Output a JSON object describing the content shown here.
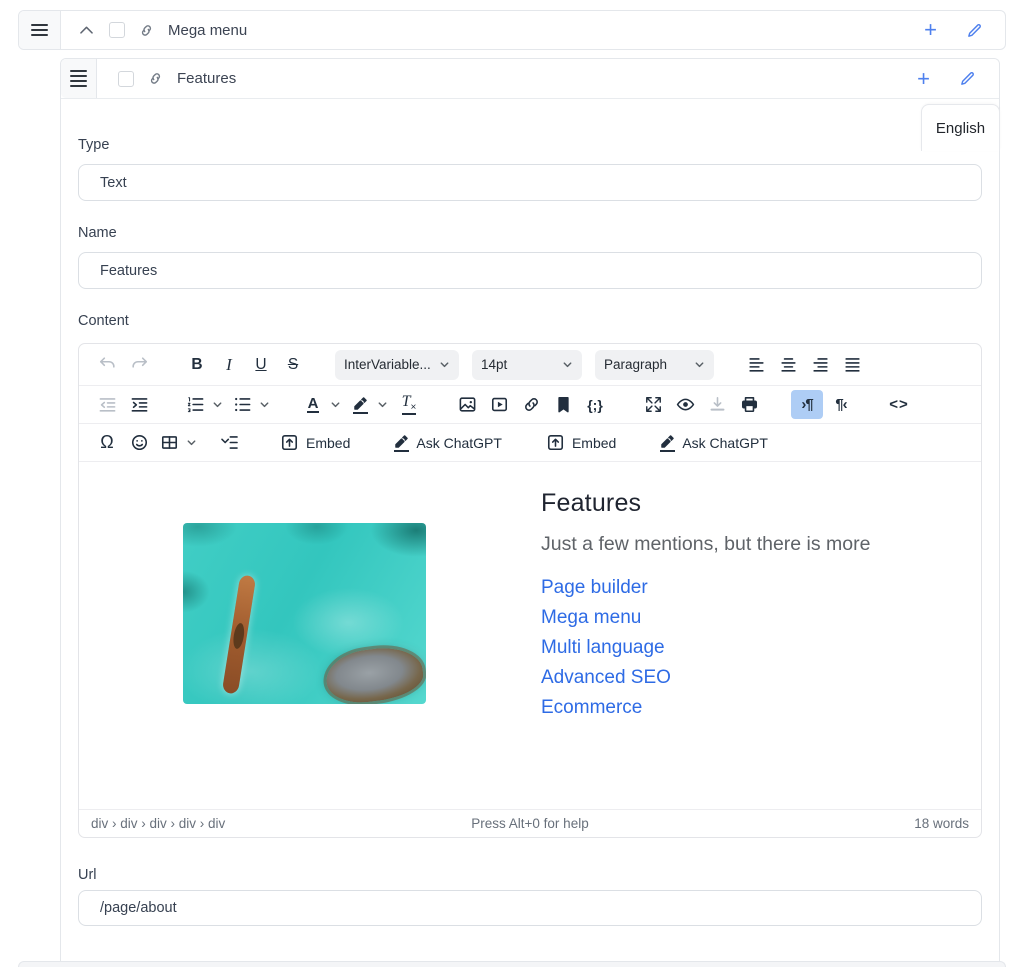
{
  "colors": {
    "accent_blue": "#4e80ee",
    "active_toolbar_bg": "#aecdf5",
    "link_blue": "#2e6be5",
    "icon_dark": "#222f3e",
    "border": "#e4e7eb"
  },
  "outer_row": {
    "title": "Mega menu"
  },
  "panel": {
    "title": "Features",
    "language_tab": "English"
  },
  "fields": {
    "type_label": "Type",
    "type_value": "Text",
    "name_label": "Name",
    "name_value": "Features",
    "content_label": "Content",
    "url_label": "Url",
    "url_value": "/page/about"
  },
  "editor": {
    "toolbar": {
      "font_family": "InterVariable...",
      "font_size": "14pt",
      "block_format": "Paragraph",
      "embed_label": "Embed",
      "ask_chatgpt_label": "Ask ChatGPT"
    },
    "glyphs": {
      "bold": "B",
      "italic": "I",
      "underline": "U",
      "strikethrough": "S",
      "forecolor": "A",
      "clear_format_t": "T",
      "clear_format_x": "×",
      "codesample": "{;}",
      "ltr": "›¶",
      "rtl": "¶‹",
      "source_code": "<>",
      "special_char": "Ω",
      "plus": "+"
    },
    "content": {
      "heading": "Features",
      "subheading": "Just a few mentions, but there is more",
      "links": [
        "Page builder",
        "Mega menu",
        "Multi language",
        "Advanced SEO",
        "Ecommerce"
      ]
    },
    "statusbar": {
      "element_path": "div › div › div › div › div",
      "help_text": "Press Alt+0 for help",
      "word_count": "18 words"
    }
  }
}
